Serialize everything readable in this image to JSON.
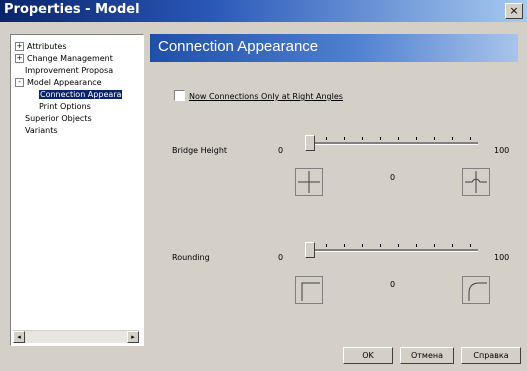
{
  "window": {
    "title": "Properties - Model",
    "close_glyph": "×"
  },
  "tree": {
    "items": [
      {
        "label": "Attributes",
        "expander": "+"
      },
      {
        "label": "Change Management",
        "expander": "+"
      },
      {
        "label": "Improvement Proposa",
        "expander": ""
      },
      {
        "label": "Model Appearance",
        "expander": "-"
      },
      {
        "label": "Connection Appeara",
        "expander": "",
        "selected": true
      },
      {
        "label": "Print Options",
        "expander": ""
      },
      {
        "label": "Superior Objects",
        "expander": ""
      },
      {
        "label": "Variants",
        "expander": ""
      }
    ],
    "scroll_left_glyph": "◂",
    "scroll_right_glyph": "▸"
  },
  "panel": {
    "title": "Connection Appearance",
    "checkbox": {
      "label": "Now Connections Only at Right Angles",
      "checked": false
    },
    "bridge": {
      "label": "Bridge Height",
      "min": "0",
      "max": "100",
      "value": "0",
      "level": 0
    },
    "rounding": {
      "label": "Rounding",
      "min": "0",
      "max": "100",
      "value": "0",
      "level": 0
    }
  },
  "buttons": {
    "ok": "OK",
    "cancel": "Отмена",
    "help": "Справка"
  },
  "colors": {
    "title_gradient_start": "#0a246a",
    "header_gradient_start": "#1f4fa8",
    "dialog_bg": "#d4d0c8",
    "selection": "#0a246a"
  },
  "icons": [
    "close-icon",
    "tree-expand-icon",
    "tree-collapse-icon",
    "scroll-left-icon",
    "scroll-right-icon",
    "bridge-preview-icon",
    "rounding-preview-icon"
  ]
}
